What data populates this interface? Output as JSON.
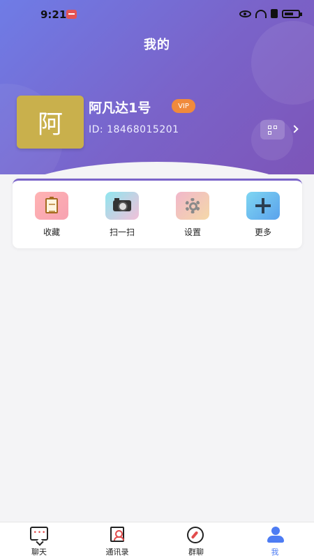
{
  "status_bar": {
    "time": "9:21"
  },
  "header": {
    "title": "我的"
  },
  "profile": {
    "avatar_char": "阿",
    "name": "阿凡达1号",
    "vip_label": "VIP",
    "id_text": "ID:  18468015201"
  },
  "actions": [
    {
      "label": "收藏",
      "icon": "clipboard-icon"
    },
    {
      "label": "扫一扫",
      "icon": "camera-icon"
    },
    {
      "label": "设置",
      "icon": "gear-icon"
    },
    {
      "label": "更多",
      "icon": "plus-icon"
    }
  ],
  "tabbar": [
    {
      "label": "聊天",
      "icon": "chat-icon"
    },
    {
      "label": "通讯录",
      "icon": "contacts-icon"
    },
    {
      "label": "群聊",
      "icon": "compass-icon"
    },
    {
      "label": "我",
      "icon": "person-icon",
      "active": true
    }
  ],
  "colors": {
    "accent": "#4d7cf3",
    "header_start": "#6f7ce6",
    "header_end": "#7d55b8",
    "vip": "#f08a3c",
    "avatar_bg": "#c9b04c"
  }
}
